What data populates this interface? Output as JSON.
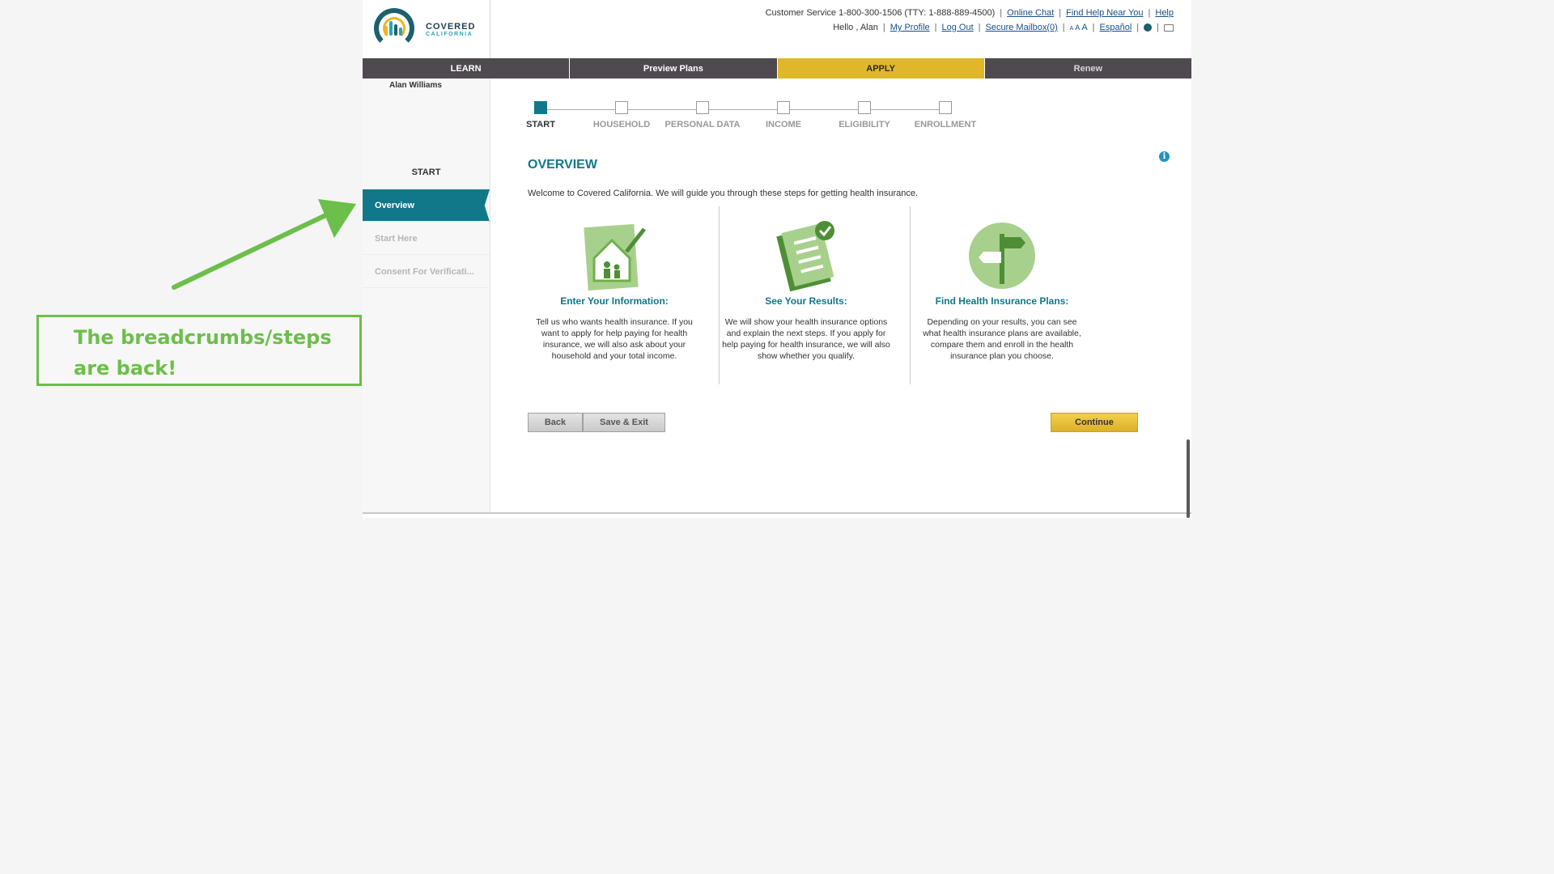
{
  "header": {
    "logo_line1": "COVERED",
    "logo_line2": "CALIFORNIA",
    "customer_service": "Customer Service 1-800-300-1506 (TTY: 1-888-889-4500)",
    "online_chat": "Online Chat",
    "find_help": "Find Help Near You",
    "help": "Help",
    "greeting": "Hello , Alan",
    "my_profile": "My Profile",
    "log_out": "Log Out",
    "secure_mailbox": "Secure Mailbox(0)",
    "font_small": "A",
    "font_medium": "A",
    "font_large": "A",
    "espanol": "Español"
  },
  "nav": {
    "tabs": [
      {
        "label": "LEARN"
      },
      {
        "label": "Preview Plans"
      },
      {
        "label": "APPLY"
      },
      {
        "label": "Renew"
      }
    ]
  },
  "sidebar": {
    "user_name": "Alan Williams",
    "section": "START",
    "items": [
      {
        "label": "Overview"
      },
      {
        "label": "Start Here"
      },
      {
        "label": "Consent For Verificati..."
      }
    ]
  },
  "steps": [
    {
      "label": "START"
    },
    {
      "label": "HOUSEHOLD"
    },
    {
      "label": "PERSONAL DATA"
    },
    {
      "label": "INCOME"
    },
    {
      "label": "ELIGIBILITY"
    },
    {
      "label": "ENROLLMENT"
    }
  ],
  "main": {
    "title": "OVERVIEW",
    "welcome": "Welcome to Covered California. We will guide you through these steps for getting health insurance.",
    "columns": [
      {
        "heading": "Enter Your Information:",
        "text": "Tell us who wants health insurance. If you want to apply for help paying for health insurance, we will also ask about your household and your total income."
      },
      {
        "heading": "See Your Results:",
        "text": "We will show your health insurance options and explain the next steps. If you apply for help paying for health insurance, we will also show whether you qualify."
      },
      {
        "heading": "Find Health Insurance Plans:",
        "text": "Depending on your results, you can see what health insurance plans are available, compare them and enroll in the health insurance plan you choose."
      }
    ],
    "back_label": "Back",
    "save_exit_label": "Save & Exit",
    "continue_label": "Continue"
  },
  "annotation": {
    "text": "The breadcrumbs/steps are back!"
  },
  "colors": {
    "teal": "#11788a",
    "apply_yellow": "#e0b62b",
    "nav_dark": "#4f4a4f",
    "annotation_green": "#6cbf4a"
  }
}
